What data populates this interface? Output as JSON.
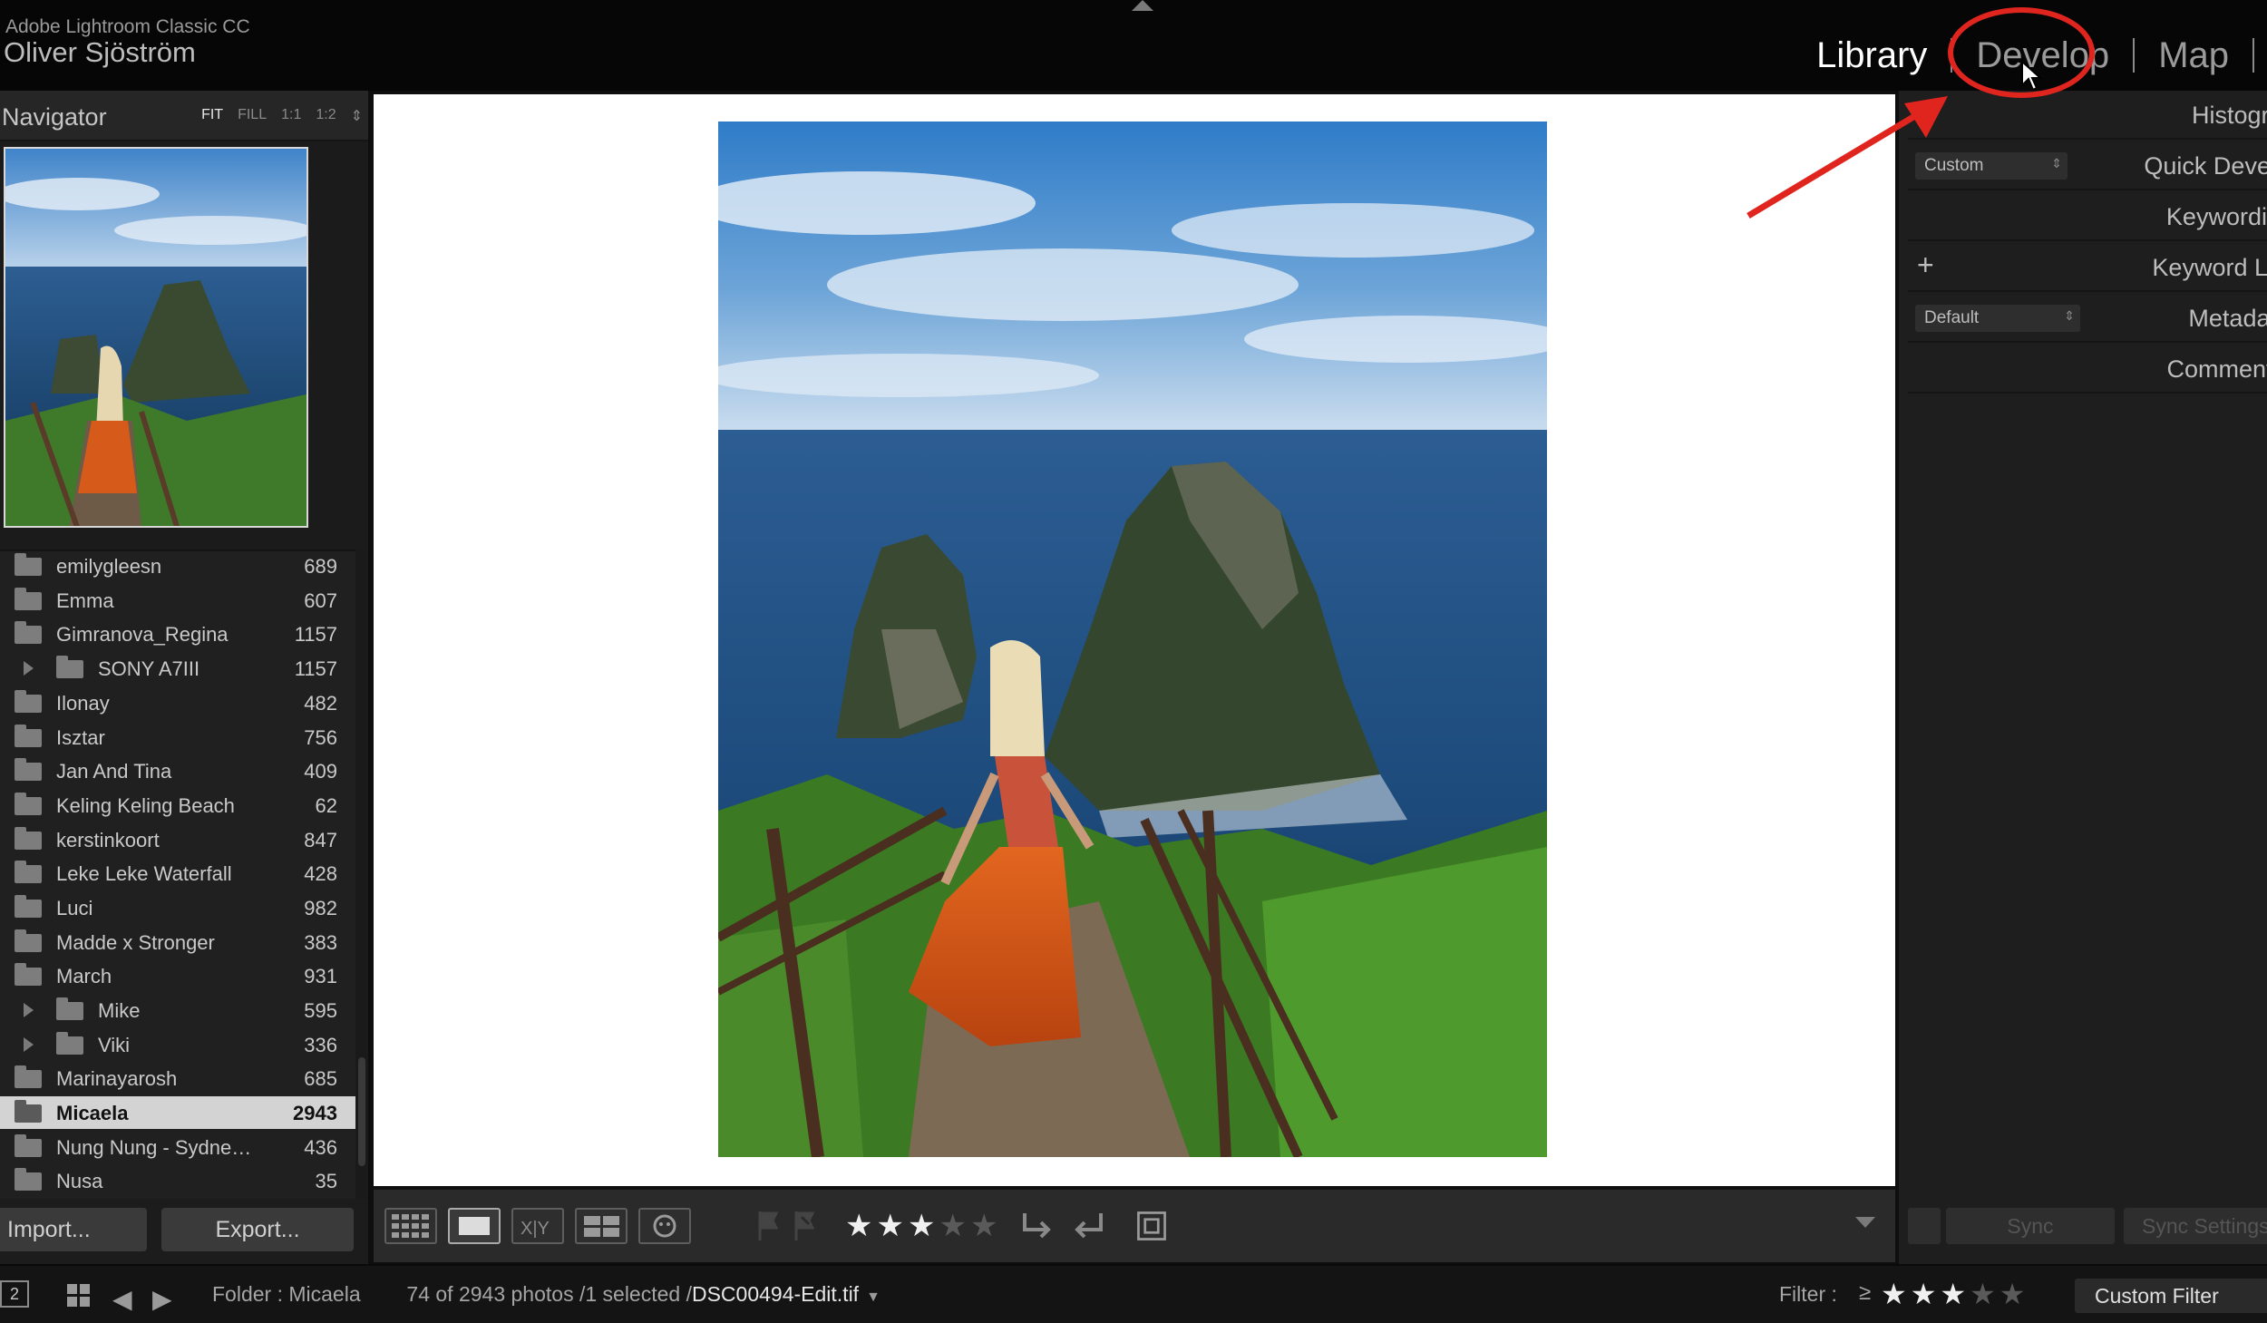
{
  "app": {
    "name": "Adobe Lightroom Classic CC",
    "user": "Oliver Sjöström"
  },
  "modules": [
    "Library",
    "Develop",
    "Map"
  ],
  "active_module": "Library",
  "annotation_color": "#e0251f",
  "navigator": {
    "title": "Navigator",
    "zoom_options": [
      "FIT",
      "FILL",
      "1:1",
      "1:2"
    ],
    "selected_zoom": "FIT"
  },
  "folders": [
    {
      "name": "emilygleesn",
      "count": "689"
    },
    {
      "name": "Emma",
      "count": "607"
    },
    {
      "name": "Gimranova_Regina",
      "count": "1157"
    },
    {
      "name": "SONY A7III",
      "count": "1157"
    },
    {
      "name": "Ilonay",
      "count": "482"
    },
    {
      "name": "Isztar",
      "count": "756"
    },
    {
      "name": "Jan And Tina",
      "count": "409"
    },
    {
      "name": "Keling Keling Beach",
      "count": "62"
    },
    {
      "name": "kerstinkoort",
      "count": "847"
    },
    {
      "name": "Leke Leke Waterfall",
      "count": "428"
    },
    {
      "name": "Luci",
      "count": "982"
    },
    {
      "name": "Madde x Stronger",
      "count": "383"
    },
    {
      "name": "March",
      "count": "931"
    },
    {
      "name": "Mike",
      "count": "595"
    },
    {
      "name": "Viki",
      "count": "336"
    },
    {
      "name": "Marinayarosh",
      "count": "685"
    },
    {
      "name": "Micaela",
      "count": "2943"
    },
    {
      "name": "Nung Nung - Sydne…",
      "count": "436"
    },
    {
      "name": "Nusa",
      "count": "35"
    }
  ],
  "left_buttons": {
    "import": "Import...",
    "export": "Export..."
  },
  "toolbar": {
    "rating": 3,
    "max_rating": 5
  },
  "right_panel": {
    "histogram": "Histogram",
    "quick_develop": "Quick Develop",
    "quick_develop_preset": "Custom",
    "keywording": "Keywording",
    "keyword_list": "Keyword List",
    "metadata": "Metadata",
    "metadata_preset": "Default",
    "comments": "Comments",
    "sync": "Sync",
    "sync_settings": "Sync Settings"
  },
  "filmstrip": {
    "monitor": "2",
    "folder_prefix": "Folder : Micaela",
    "count_text": "74 of 2943 photos /1 selected /",
    "filename": "DSC00494-Edit.tif",
    "filter_label": "Filter :",
    "filter_op": "≥",
    "filter_rating": 3,
    "custom_filter": "Custom Filter"
  }
}
